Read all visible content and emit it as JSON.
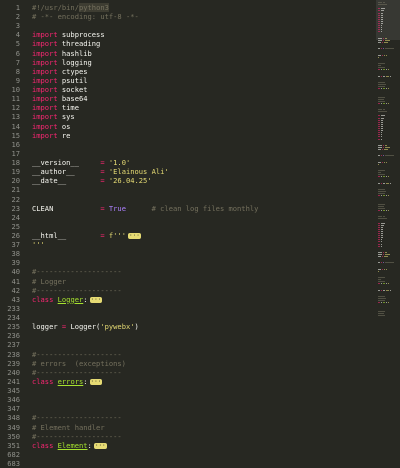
{
  "colors": {
    "background": "#272822",
    "line_number": "#8f908a",
    "default": "#f8f8f2",
    "keyword": "#f92672",
    "comment": "#75715e",
    "string": "#e6db74",
    "constant": "#ae81ff",
    "class": "#a6e22e"
  },
  "lines": [
    {
      "n": "1",
      "tokens": [
        {
          "text": "#!/usr/bin/",
          "type": "comment"
        },
        {
          "text": "python3",
          "type": "comment-hl"
        }
      ]
    },
    {
      "n": "2",
      "tokens": [
        {
          "text": "# -*- encoding: utf-8 -*-",
          "type": "comment"
        }
      ]
    },
    {
      "n": "3",
      "tokens": []
    },
    {
      "n": "4",
      "tokens": [
        {
          "text": "import",
          "type": "keyword"
        },
        {
          "text": " subprocess",
          "type": "default"
        }
      ]
    },
    {
      "n": "5",
      "tokens": [
        {
          "text": "import",
          "type": "keyword"
        },
        {
          "text": " threading",
          "type": "default"
        }
      ]
    },
    {
      "n": "6",
      "tokens": [
        {
          "text": "import",
          "type": "keyword"
        },
        {
          "text": " hashlib",
          "type": "default"
        }
      ]
    },
    {
      "n": "7",
      "tokens": [
        {
          "text": "import",
          "type": "keyword"
        },
        {
          "text": " logging",
          "type": "default"
        }
      ]
    },
    {
      "n": "8",
      "tokens": [
        {
          "text": "import",
          "type": "keyword"
        },
        {
          "text": " ctypes",
          "type": "default"
        }
      ]
    },
    {
      "n": "9",
      "tokens": [
        {
          "text": "import",
          "type": "keyword"
        },
        {
          "text": " psutil",
          "type": "default"
        }
      ]
    },
    {
      "n": "10",
      "tokens": [
        {
          "text": "import",
          "type": "keyword"
        },
        {
          "text": " socket",
          "type": "default"
        }
      ]
    },
    {
      "n": "11",
      "tokens": [
        {
          "text": "import",
          "type": "keyword"
        },
        {
          "text": " base64",
          "type": "default"
        }
      ]
    },
    {
      "n": "12",
      "tokens": [
        {
          "text": "import",
          "type": "keyword"
        },
        {
          "text": " time",
          "type": "default"
        }
      ]
    },
    {
      "n": "13",
      "tokens": [
        {
          "text": "import",
          "type": "keyword"
        },
        {
          "text": " sys",
          "type": "default"
        }
      ]
    },
    {
      "n": "14",
      "tokens": [
        {
          "text": "import",
          "type": "keyword"
        },
        {
          "text": " os",
          "type": "default"
        }
      ]
    },
    {
      "n": "15",
      "tokens": [
        {
          "text": "import",
          "type": "keyword"
        },
        {
          "text": " re",
          "type": "default"
        }
      ]
    },
    {
      "n": "16",
      "tokens": []
    },
    {
      "n": "17",
      "tokens": []
    },
    {
      "n": "18",
      "tokens": [
        {
          "text": "__version__",
          "type": "default"
        },
        {
          "text": "     = ",
          "type": "keyword"
        },
        {
          "text": "'1.0'",
          "type": "string"
        }
      ]
    },
    {
      "n": "19",
      "tokens": [
        {
          "text": "__author__",
          "type": "default"
        },
        {
          "text": "      = ",
          "type": "keyword"
        },
        {
          "text": "'Elainous Ali'",
          "type": "string"
        }
      ]
    },
    {
      "n": "20",
      "tokens": [
        {
          "text": "__date__",
          "type": "default"
        },
        {
          "text": "        = ",
          "type": "keyword"
        },
        {
          "text": "'26.04.25'",
          "type": "string"
        }
      ]
    },
    {
      "n": "21",
      "tokens": []
    },
    {
      "n": "22",
      "tokens": []
    },
    {
      "n": "23",
      "tokens": [
        {
          "text": "CLEAN",
          "type": "default"
        },
        {
          "text": "           = ",
          "type": "keyword"
        },
        {
          "text": "True",
          "type": "constant"
        },
        {
          "text": "      # clean log files monthly",
          "type": "comment"
        }
      ]
    },
    {
      "n": "24",
      "tokens": []
    },
    {
      "n": "25",
      "tokens": []
    },
    {
      "n": "26",
      "tokens": [
        {
          "text": "__html__",
          "type": "default"
        },
        {
          "text": "        = ",
          "type": "keyword"
        },
        {
          "text": "f'''",
          "type": "string"
        },
        {
          "text": "···",
          "type": "fold"
        }
      ]
    },
    {
      "n": "37",
      "tokens": [
        {
          "text": "'''",
          "type": "string"
        }
      ]
    },
    {
      "n": "38",
      "tokens": []
    },
    {
      "n": "39",
      "tokens": []
    },
    {
      "n": "40",
      "tokens": [
        {
          "text": "#--------------------",
          "type": "comment"
        }
      ]
    },
    {
      "n": "41",
      "tokens": [
        {
          "text": "# Logger",
          "type": "comment"
        }
      ]
    },
    {
      "n": "42",
      "tokens": [
        {
          "text": "#--------------------",
          "type": "comment"
        }
      ]
    },
    {
      "n": "43",
      "tokens": [
        {
          "text": "class",
          "type": "keyword"
        },
        {
          "text": " ",
          "type": "default"
        },
        {
          "text": "Logger",
          "type": "class"
        },
        {
          "text": ":",
          "type": "default"
        },
        {
          "text": "···",
          "type": "fold"
        }
      ]
    },
    {
      "n": "233",
      "tokens": []
    },
    {
      "n": "234",
      "tokens": []
    },
    {
      "n": "235",
      "tokens": [
        {
          "text": "logger",
          "type": "default"
        },
        {
          "text": " = ",
          "type": "keyword"
        },
        {
          "text": "Logger(",
          "type": "default"
        },
        {
          "text": "'pywebx'",
          "type": "string"
        },
        {
          "text": ")",
          "type": "default"
        }
      ]
    },
    {
      "n": "236",
      "tokens": []
    },
    {
      "n": "237",
      "tokens": []
    },
    {
      "n": "238",
      "tokens": [
        {
          "text": "#--------------------",
          "type": "comment"
        }
      ]
    },
    {
      "n": "239",
      "tokens": [
        {
          "text": "# errors  (exceptions)",
          "type": "comment"
        }
      ]
    },
    {
      "n": "240",
      "tokens": [
        {
          "text": "#--------------------",
          "type": "comment"
        }
      ]
    },
    {
      "n": "241",
      "tokens": [
        {
          "text": "class",
          "type": "keyword"
        },
        {
          "text": " ",
          "type": "default"
        },
        {
          "text": "errors",
          "type": "class"
        },
        {
          "text": ":",
          "type": "default"
        },
        {
          "text": "···",
          "type": "fold"
        }
      ]
    },
    {
      "n": "345",
      "tokens": []
    },
    {
      "n": "346",
      "tokens": []
    },
    {
      "n": "347",
      "tokens": []
    },
    {
      "n": "348",
      "tokens": [
        {
          "text": "#--------------------",
          "type": "comment"
        }
      ]
    },
    {
      "n": "349",
      "tokens": [
        {
          "text": "# Element handler",
          "type": "comment"
        }
      ]
    },
    {
      "n": "350",
      "tokens": [
        {
          "text": "#--------------------",
          "type": "comment"
        }
      ]
    },
    {
      "n": "351",
      "tokens": [
        {
          "text": "class",
          "type": "keyword"
        },
        {
          "text": " ",
          "type": "default"
        },
        {
          "text": "Element",
          "type": "class"
        },
        {
          "text": ":",
          "type": "default"
        },
        {
          "text": "···",
          "type": "fold"
        }
      ]
    },
    {
      "n": "682",
      "tokens": []
    },
    {
      "n": "683",
      "tokens": []
    }
  ]
}
